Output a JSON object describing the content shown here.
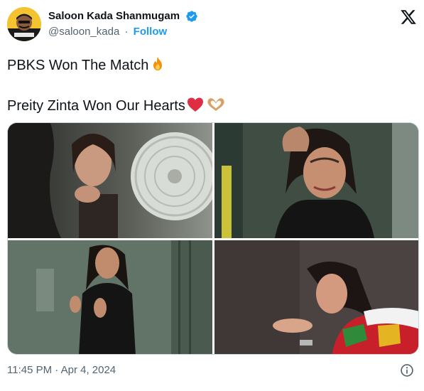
{
  "author": {
    "display_name": "Saloon Kada Shanmugam",
    "handle": "@saloon_kada",
    "separator": "·",
    "follow_label": "Follow",
    "verified_color": "#1d9bf0"
  },
  "icons": {
    "verified": "verified-badge-icon",
    "brand": "x-logo-icon",
    "info": "info-icon",
    "fire": "fire-emoji",
    "heart": "red-heart-emoji",
    "heart_hands": "heart-hands-emoji"
  },
  "tweet": {
    "line1": "PBKS Won The Match",
    "line2": "Preity Zinta Won Our Hearts"
  },
  "media": {
    "count": 4
  },
  "footer": {
    "timestamp": "11:45 PM · Apr 4, 2024"
  },
  "colors": {
    "text": "#0f1419",
    "muted": "#536471",
    "accent": "#1d9bf0",
    "border": "#cfd9de"
  }
}
